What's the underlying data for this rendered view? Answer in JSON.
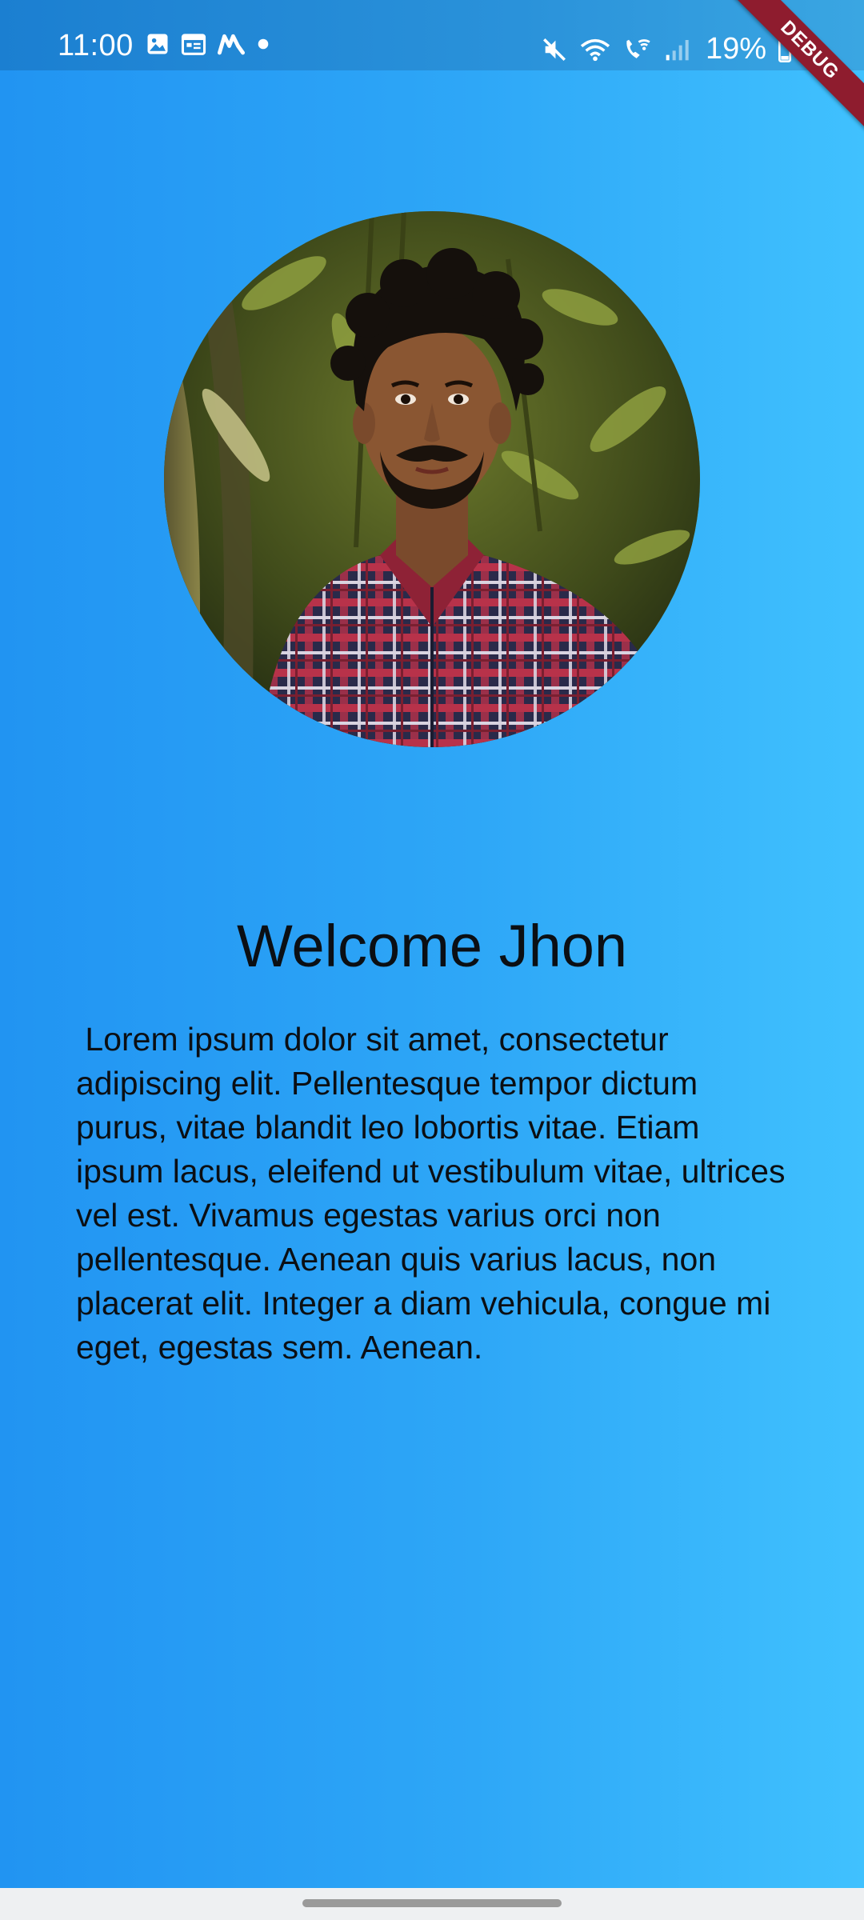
{
  "status_bar": {
    "time": "11:00",
    "left_icons": [
      "image-icon",
      "calendar-icon",
      "maps-icon",
      "dot-icon"
    ],
    "right_icons": [
      "mute-icon",
      "wifi-icon",
      "wifi-calling-icon",
      "signal-icon"
    ],
    "battery": "19%",
    "battery_icon": "battery-icon"
  },
  "debug_banner": {
    "label": "DEBUG",
    "color": "#8e1c2e"
  },
  "profile": {
    "avatar_icon": "profile-photo",
    "welcome_text": "Welcome Jhon",
    "description": " Lorem ipsum dolor sit amet, consectetur adipiscing elit. Pellentesque tempor dictum purus, vitae blandit leo lobortis vitae. Etiam ipsum lacus, eleifend ut vestibulum vitae, ultrices vel est. Vivamus egestas varius orci non pellentesque. Aenean quis varius lacus, non placerat elit. Integer a diam vehicula, congue mi eget, egestas sem. Aenean."
  },
  "colors": {
    "gradient_start": "#2194f2",
    "gradient_end": "#40c1fe",
    "text": "#0b0f14"
  }
}
